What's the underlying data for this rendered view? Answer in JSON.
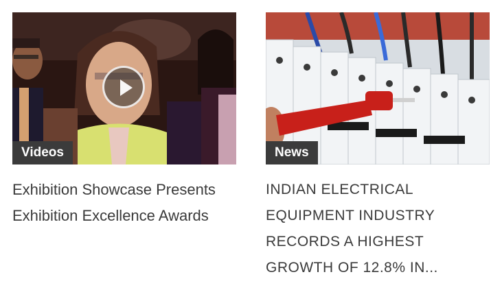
{
  "cards": [
    {
      "category": "Videos",
      "title": "Exhibition Showcase Presents Exhibition Excellence Awards",
      "thumbnail_icon": "play-icon"
    },
    {
      "category": "News",
      "title": "INDIAN ELECTRICAL EQUIPMENT INDUSTRY RECORDS A HIGHEST GROWTH OF 12.8% IN..."
    }
  ],
  "colors": {
    "badge_bg": "#3b3b3b",
    "badge_text": "#ffffff",
    "title_text": "#3a3a3a",
    "background": "#ffffff"
  }
}
